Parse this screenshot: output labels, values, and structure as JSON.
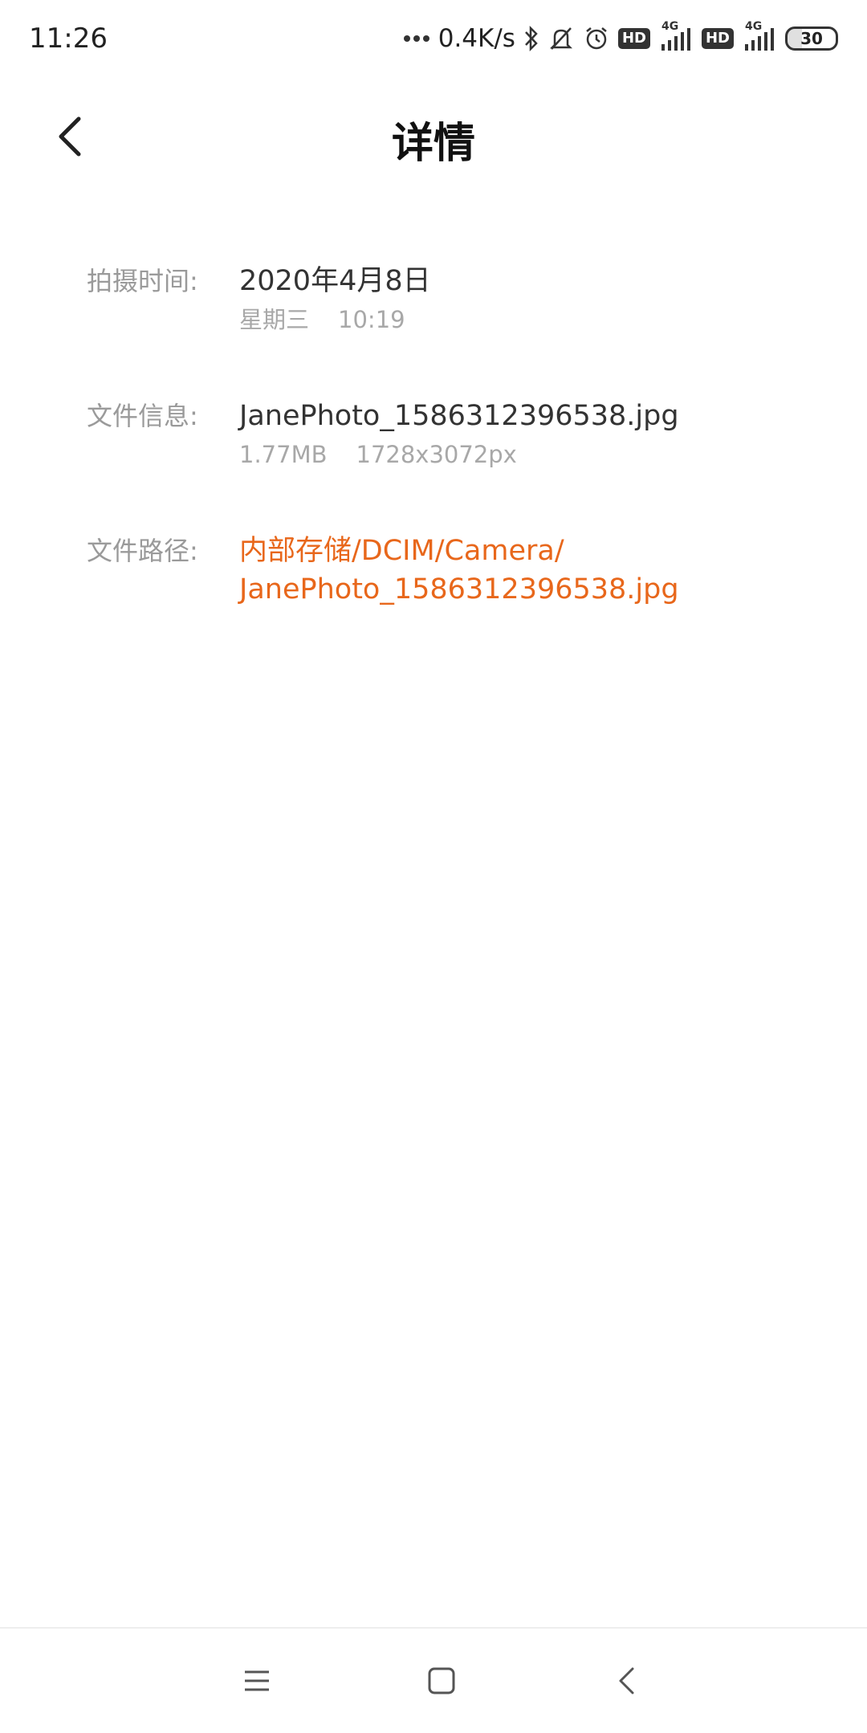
{
  "status_bar": {
    "time": "11:26",
    "net_speed": "0.4K/s",
    "hd_badge_1": "HD",
    "hd_badge_2": "HD",
    "network_1": "4G",
    "network_2": "4G",
    "battery": "30",
    "icons": [
      "bluetooth-icon",
      "mute-icon",
      "alarm-icon",
      "signal-icon"
    ]
  },
  "header": {
    "title": "详情",
    "back_icon": "chevron-left-icon"
  },
  "details": {
    "capture_time": {
      "label": "拍摄时间:",
      "date": "2020年4月8日",
      "weekday": "星期三",
      "time": "10:19"
    },
    "file_info": {
      "label": "文件信息:",
      "filename": "JanePhoto_1586312396538.jpg",
      "size": "1.77MB",
      "dimensions": "1728x3072px"
    },
    "file_path": {
      "label": "文件路径:",
      "path_line1": "内部存储/DCIM/Camera/",
      "path_line2": "JanePhoto_1586312396538.jpg"
    }
  },
  "nav_bar": {
    "icons": [
      "menu-icon",
      "home-icon",
      "back-icon"
    ]
  },
  "colors": {
    "accent": "#e8671b",
    "label": "#9a9a9a",
    "sub_text": "#a8a8a8"
  }
}
